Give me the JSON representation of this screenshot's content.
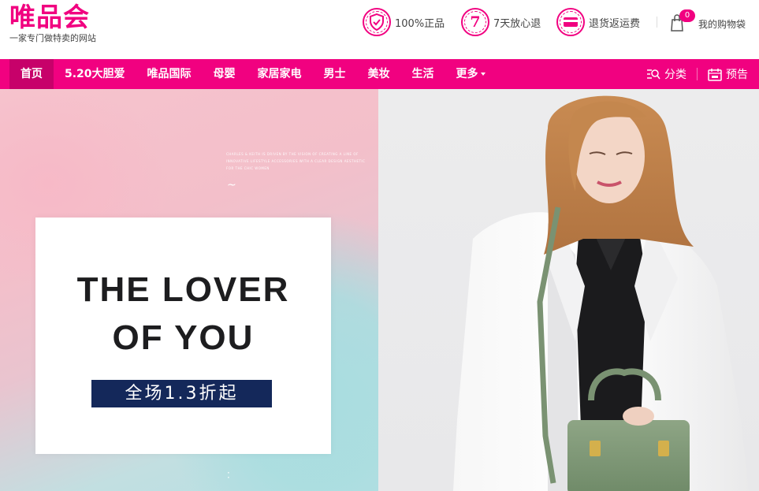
{
  "header": {
    "logo": {
      "title": "唯品会",
      "tagline": "一家专门做特卖的网站"
    },
    "promises": [
      {
        "icon": "shield-check-icon",
        "label": "100%正品"
      },
      {
        "icon": "seven-day-icon",
        "badge": "7",
        "label": "7天放心退"
      },
      {
        "icon": "card-icon",
        "label": "退货返运费"
      }
    ],
    "cart": {
      "count": "0",
      "label": "我的购物袋"
    }
  },
  "nav": {
    "items": [
      {
        "label": "首页",
        "active": true
      },
      {
        "label": "5.20大胆爱"
      },
      {
        "label": "唯品国际"
      },
      {
        "label": "母婴"
      },
      {
        "label": "家居家电"
      },
      {
        "label": "男士"
      },
      {
        "label": "美妆"
      },
      {
        "label": "生活"
      },
      {
        "label": "更多",
        "dropdown": true
      }
    ],
    "tools": [
      {
        "icon": "category-search-icon",
        "label": "分类"
      },
      {
        "icon": "calendar-icon",
        "label": "预告"
      }
    ]
  },
  "banner": {
    "small_copy": "CHARLES & KEITH IS DRIVEN BY THE VISION OF CREATING A LINE OF INNOVATIVE LIFESTYLE ACCESSORIES WITH A CLEAR DESIGN AESTHETIC FOR THE CHIC WOMEN",
    "headline_line1": "THE LOVER",
    "headline_line2": "OF YOU",
    "sale_text": "全场1.3折起"
  },
  "colors": {
    "brand": "#f10180",
    "nav_active": "#c7016a",
    "sale_tag": "#14285a"
  }
}
